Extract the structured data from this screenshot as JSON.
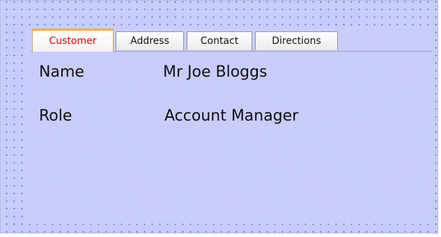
{
  "tabs": [
    {
      "label": "Customer",
      "active": true
    },
    {
      "label": "Address",
      "active": false
    },
    {
      "label": "Contact",
      "active": false
    },
    {
      "label": "Directions",
      "active": false
    }
  ],
  "fields": {
    "name": {
      "label": "Name",
      "value": "Mr Joe Bloggs"
    },
    "role": {
      "label": "Role",
      "value": "Account Manager"
    }
  },
  "colors": {
    "background": "#c8ccfc",
    "dots": "#6c6fa8",
    "active_tab_text": "#e00000",
    "active_tab_accent": "#f2b230"
  }
}
